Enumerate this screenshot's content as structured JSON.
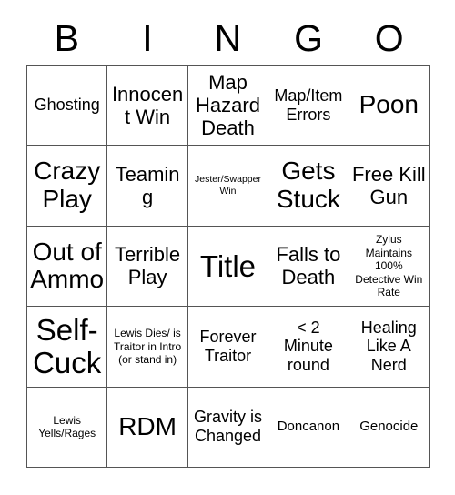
{
  "header": {
    "letters": [
      "B",
      "I",
      "N",
      "G",
      "O"
    ]
  },
  "grid": {
    "rows": [
      [
        {
          "text": "Ghosting",
          "size": "md"
        },
        {
          "text": "Innocent Win",
          "size": "lg"
        },
        {
          "text": "Map Hazard Death",
          "size": "lg"
        },
        {
          "text": "Map/Item Errors",
          "size": "md"
        },
        {
          "text": "Poon",
          "size": "xl"
        }
      ],
      [
        {
          "text": "Crazy Play",
          "size": "xl"
        },
        {
          "text": "Teaming",
          "size": "lg"
        },
        {
          "text": "Jester/Swapper Win",
          "size": "xxs"
        },
        {
          "text": "Gets Stuck",
          "size": "xl"
        },
        {
          "text": "Free Kill Gun",
          "size": "lg"
        }
      ],
      [
        {
          "text": "Out of Ammo",
          "size": "xl"
        },
        {
          "text": "Terrible Play",
          "size": "lg"
        },
        {
          "text": "Title",
          "size": "xxl"
        },
        {
          "text": "Falls to Death",
          "size": "lg"
        },
        {
          "text": "Zylus Maintains 100% Detective Win Rate",
          "size": "xs"
        }
      ],
      [
        {
          "text": "Self-Cuck",
          "size": "xxl"
        },
        {
          "text": "Lewis Dies/ is Traitor in Intro (or stand in)",
          "size": "xs"
        },
        {
          "text": "Forever Traitor",
          "size": "md"
        },
        {
          "text": "< 2 Minute round",
          "size": "md"
        },
        {
          "text": "Healing Like A Nerd",
          "size": "md"
        }
      ],
      [
        {
          "text": "Lewis Yells/Rages",
          "size": "xs"
        },
        {
          "text": "RDM",
          "size": "xl"
        },
        {
          "text": "Gravity is Changed",
          "size": "md"
        },
        {
          "text": "Doncanon",
          "size": "sm"
        },
        {
          "text": "Genocide",
          "size": "sm"
        }
      ]
    ]
  },
  "colors": {
    "border": "#555555",
    "text": "#000000",
    "background": "#ffffff"
  }
}
